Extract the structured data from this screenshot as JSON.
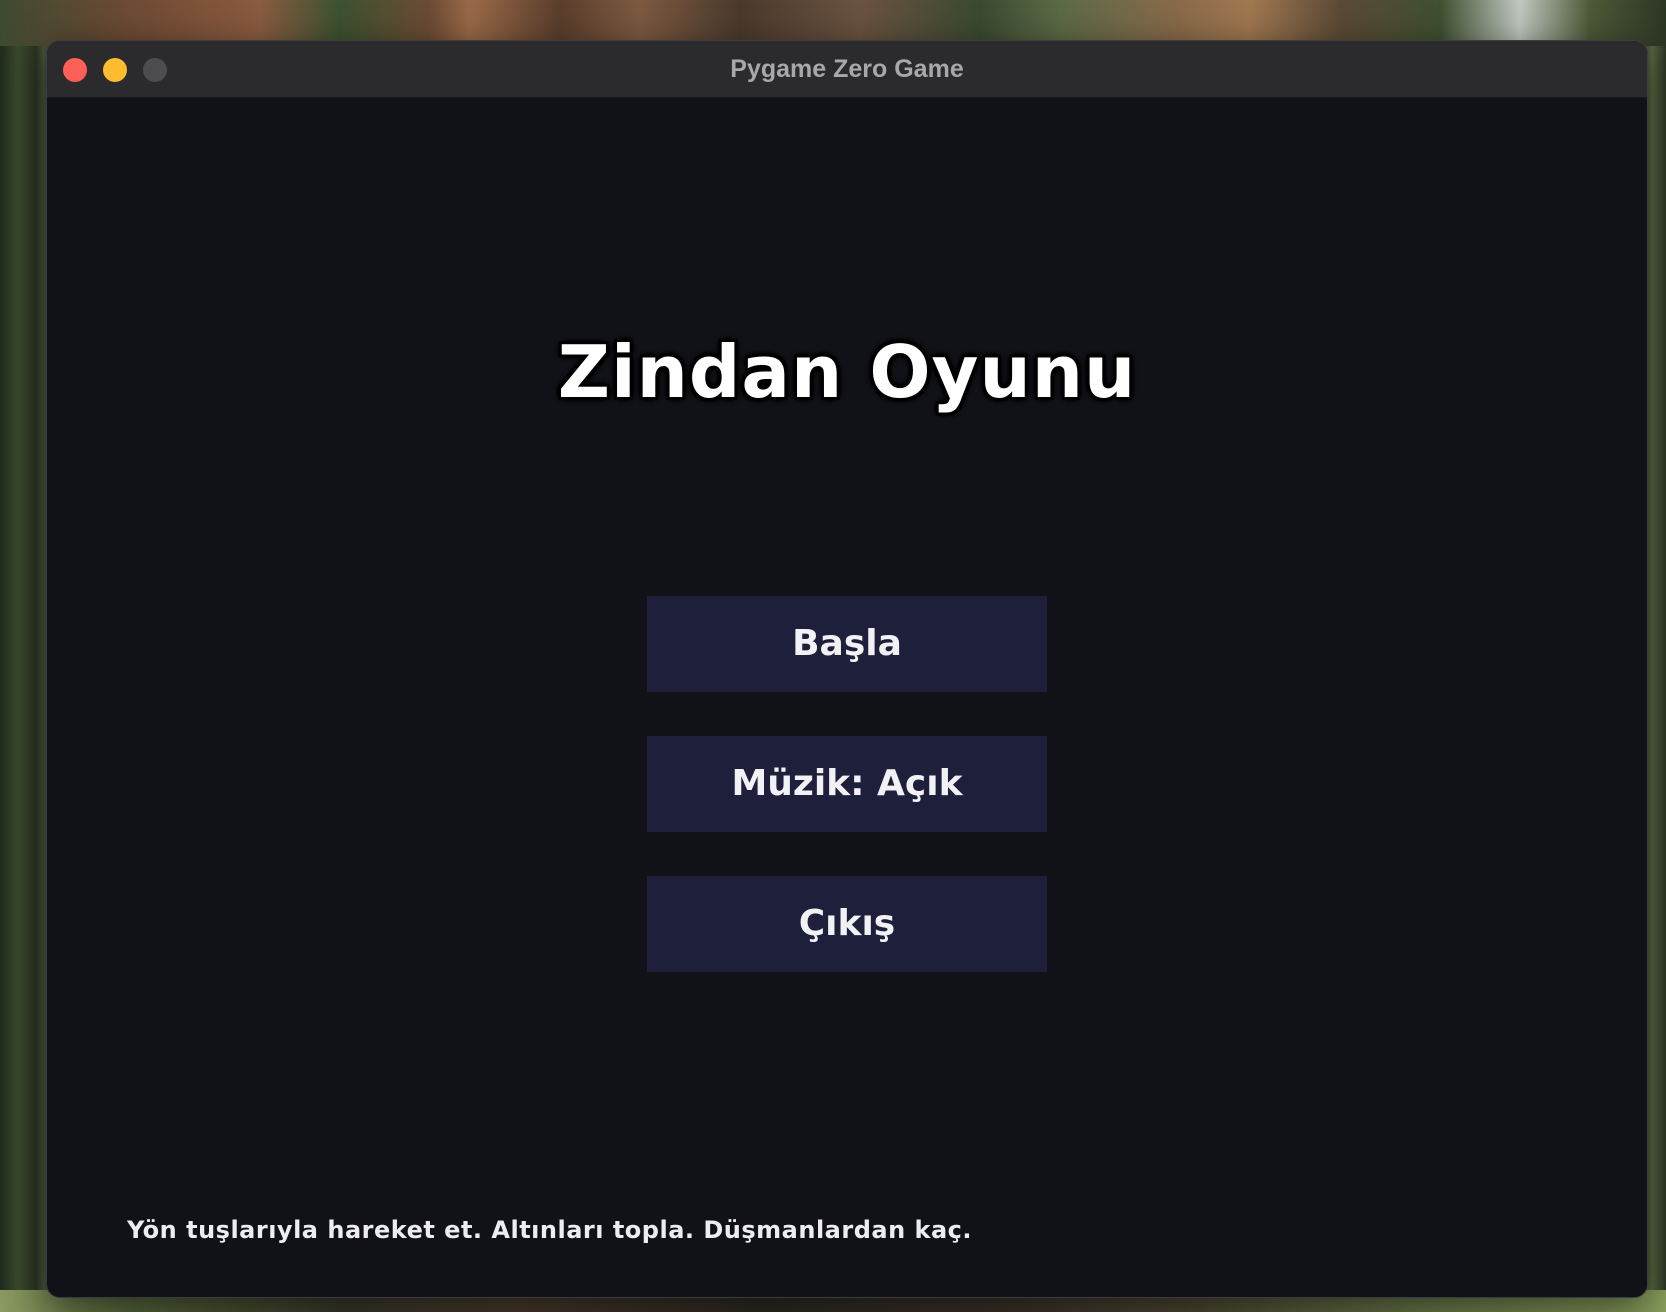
{
  "window": {
    "title": "Pygame Zero Game"
  },
  "game": {
    "title": "Zindan Oyunu",
    "menu": {
      "start_label": "Başla",
      "music_label": "Müzik: Açık",
      "exit_label": "Çıkış"
    },
    "instructions": "Yön tuşlarıyla hareket et. Altınları topla. Düşmanlardan kaç."
  },
  "colors": {
    "window_bg": "#111218",
    "titlebar_bg": "#2b2b2d",
    "button_bg": "#1e1f3a",
    "title_text": "#ffffff",
    "close_button": "#fe5f57",
    "minimize_button": "#febc2e",
    "zoom_button": "#4d4d50"
  },
  "icons": {
    "close": "close-icon",
    "minimize": "minimize-icon",
    "zoom": "zoom-icon"
  }
}
